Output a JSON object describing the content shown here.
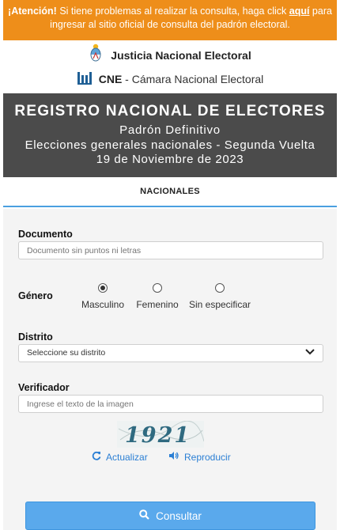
{
  "alert": {
    "bold": "¡Atención!",
    "text_before": " Si tiene problemas al realizar la consulta, haga click ",
    "link": "aquí",
    "text_after": " para ingresar al sitio oficial de consulta del padrón electoral."
  },
  "brand": {
    "jne": "Justicia Nacional Electoral",
    "cne_abbr": "CNE",
    "cne_full": " - Cámara Nacional Electoral"
  },
  "banner": {
    "title": "REGISTRO NACIONAL DE ELECTORES",
    "subtitle": "Padrón Definitivo",
    "election": "Elecciones generales nacionales - Segunda Vuelta",
    "date": "19 de Noviembre de 2023"
  },
  "tabs": [
    {
      "label": "NACIONALES",
      "active": true
    }
  ],
  "form": {
    "documento": {
      "label": "Documento",
      "placeholder": "Documento sin puntos ni letras"
    },
    "genero": {
      "label": "Género",
      "options": [
        {
          "label": "Masculino",
          "checked": true
        },
        {
          "label": "Femenino",
          "checked": false
        },
        {
          "label": "Sin especificar",
          "checked": false
        }
      ]
    },
    "distrito": {
      "label": "Distrito",
      "value": "Seleccione su distrito"
    },
    "verificador": {
      "label": "Verificador",
      "placeholder": "Ingrese el texto de la imagen"
    },
    "captcha_text": "1921",
    "actualizar": "Actualizar",
    "reproducir": "Reproducir",
    "submit": "Consultar"
  },
  "colors": {
    "alert": "#ee8e1a",
    "banner": "#4b4b4b",
    "accent": "#4a9fe0",
    "link": "#2b7fd4",
    "button": "#5aa9ec"
  },
  "icons": {
    "coat_of_arms": "escudo-icon",
    "cne_logo": "cne-logo-icon",
    "refresh": "refresh-icon",
    "audio": "volume-icon",
    "search": "search-icon",
    "select_caret": "chevron-down-icon"
  }
}
